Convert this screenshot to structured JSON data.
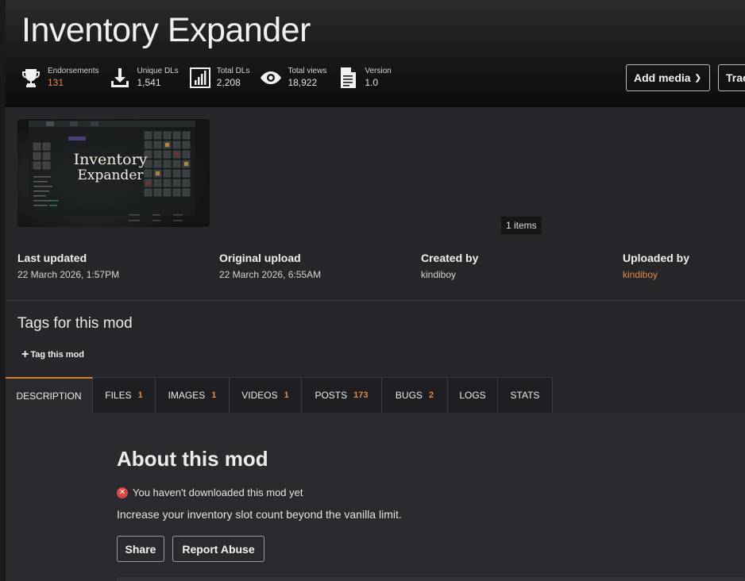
{
  "mod": {
    "title": "Inventory Expander"
  },
  "stats": [
    {
      "icon": "trophy-icon",
      "label": "Endorsements",
      "value": "131",
      "accent": true
    },
    {
      "icon": "download-icon",
      "label": "Unique DLs",
      "value": "1,541",
      "accent": false
    },
    {
      "icon": "bar-chart-icon",
      "label": "Total DLs",
      "value": "2,208",
      "accent": false
    },
    {
      "icon": "eye-icon",
      "label": "Total views",
      "value": "18,922",
      "accent": false
    },
    {
      "icon": "document-icon",
      "label": "Version",
      "value": "1.0",
      "accent": false
    }
  ],
  "header_actions": {
    "add_media": "Add media",
    "track": "Track"
  },
  "media": {
    "thumbnail_title_line1": "Inventory",
    "thumbnail_title_line2": "Expander",
    "items_count": "1 items"
  },
  "meta": {
    "last_updated_label": "Last updated",
    "last_updated": "22 March 2026, 1:57PM",
    "original_upload_label": "Original upload",
    "original_upload": "22 March 2026, 6:55AM",
    "created_by_label": "Created by",
    "created_by": "kindiboy",
    "uploaded_by_label": "Uploaded by",
    "uploaded_by": "kindiboy"
  },
  "tags": {
    "title": "Tags for this mod",
    "tag_button": "Tag this mod"
  },
  "tabs": [
    {
      "label": "Description",
      "count": ""
    },
    {
      "label": "Files",
      "count": "1"
    },
    {
      "label": "Images",
      "count": "1"
    },
    {
      "label": "Videos",
      "count": "1"
    },
    {
      "label": "Posts",
      "count": "173"
    },
    {
      "label": "Bugs",
      "count": "2"
    },
    {
      "label": "Logs",
      "count": ""
    },
    {
      "label": "Stats",
      "count": ""
    }
  ],
  "about": {
    "title": "About this mod",
    "notice": "You haven't downloaded this mod yet",
    "description": "Increase your inventory slot count beyond the vanilla limit.",
    "share": "Share",
    "report": "Report Abuse"
  },
  "colors": {
    "accent": "#e08a47",
    "tab_active": "#d87a32",
    "error": "#d84848"
  }
}
